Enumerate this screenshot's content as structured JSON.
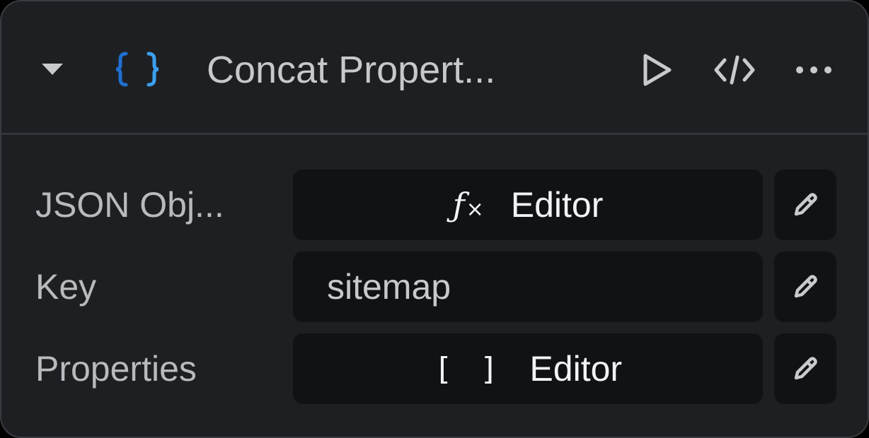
{
  "node": {
    "title": "Concat Propert...",
    "icon": "braces-icon",
    "actions": {
      "collapse_icon": "caret-down-icon",
      "run_icon": "play-icon",
      "code_icon": "code-icon",
      "more_icon": "more-horizontal-icon"
    },
    "fields": [
      {
        "label": "JSON Obj...",
        "type": "function",
        "icon": "fx-icon",
        "value": "Editor",
        "edit_icon": "pencil-icon"
      },
      {
        "label": "Key",
        "type": "text",
        "value": "sitemap",
        "edit_icon": "pencil-icon"
      },
      {
        "label": "Properties",
        "type": "array",
        "icon": "brackets-icon",
        "value": "Editor",
        "edit_icon": "pencil-icon"
      }
    ]
  },
  "colors": {
    "panel_bg": "#1e1f23",
    "field_bg": "#111215",
    "accent_blue": "#2f8ee6",
    "text": "#c7c8cc"
  }
}
